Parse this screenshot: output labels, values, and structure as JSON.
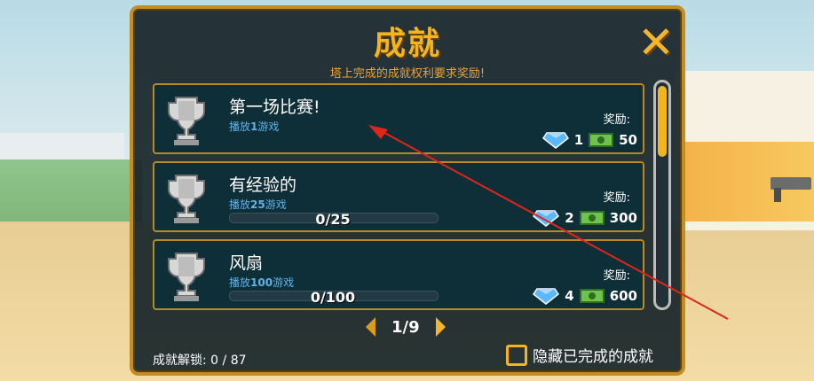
{
  "panel": {
    "title": "成就",
    "subtitle": "塔上完成的成就权利要求奖励!"
  },
  "achievements": [
    {
      "name": "第一场比赛!",
      "desc_prefix": "播放",
      "desc_count": "1",
      "desc_suffix": "游戏",
      "progress_text": "",
      "reward_label": "奖励:",
      "gems": "1",
      "cash": "50"
    },
    {
      "name": "有经验的",
      "desc_prefix": "播放",
      "desc_count": "25",
      "desc_suffix": "游戏",
      "progress_text": "0/25",
      "progress": 0,
      "reward_label": "奖励:",
      "gems": "2",
      "cash": "300"
    },
    {
      "name": "风扇",
      "desc_prefix": "播放",
      "desc_count": "100",
      "desc_suffix": "游戏",
      "progress_text": "0/100",
      "progress": 0,
      "reward_label": "奖励:",
      "gems": "4",
      "cash": "600"
    }
  ],
  "pager": {
    "text": "1/9"
  },
  "footer": {
    "unlocked": "成就解锁: 0 / 87",
    "hide_completed": "隐藏已完成的成就"
  },
  "colors": {
    "accent": "#f2b51d",
    "panel_bg": "#19262a",
    "row_bg": "#0e2e38",
    "desc_blue": "#5fb4e9",
    "annotation_arrow": "#e0251b"
  },
  "icons": [
    "trophy-icon",
    "diamond-icon",
    "cash-icon",
    "close-icon",
    "left-arrow-icon",
    "right-arrow-icon"
  ]
}
